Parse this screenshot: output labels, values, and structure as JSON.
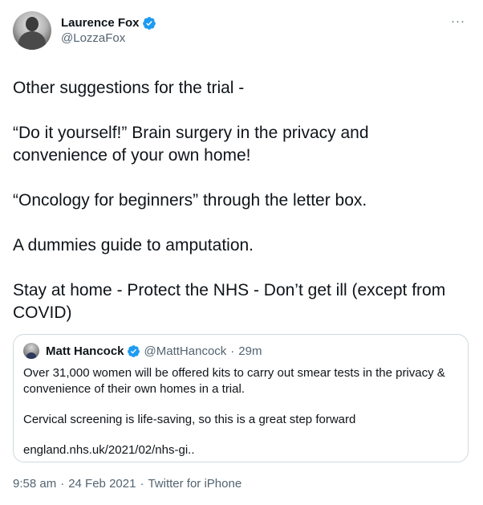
{
  "author": {
    "display_name": "Laurence Fox",
    "handle": "@LozzaFox",
    "verified_icon": "verified-badge-icon",
    "avatar": "profile-photo"
  },
  "more_icon": "more-options-icon",
  "more_glyph": "···",
  "tweet_paragraphs": [
    "Other suggestions for the trial -",
    "“Do it yourself!” Brain surgery in the privacy and convenience of your own home!",
    "“Oncology for beginners” through the letter box.",
    "A dummies guide to amputation.",
    "Stay at home - Protect the NHS - Don’t get ill (except from COVID)"
  ],
  "quoted_tweet": {
    "display_name": "Matt Hancock",
    "handle": "@MattHancock",
    "separator": "·",
    "time": "29m",
    "paragraphs": [
      "Over 31,000 women will be offered kits to carry out smear tests in the privacy & convenience of their own homes in a trial.",
      "Cervical screening is life-saving, so this is a great step forward",
      "england.nhs.uk/2021/02/nhs-gi.."
    ]
  },
  "footer": {
    "time": "9:58 am",
    "separator": "·",
    "date": "24 Feb 2021",
    "source": "Twitter for iPhone"
  },
  "colors": {
    "verified_blue": "#1d9bf0",
    "secondary_text": "#536471",
    "border": "#cfd9de"
  }
}
